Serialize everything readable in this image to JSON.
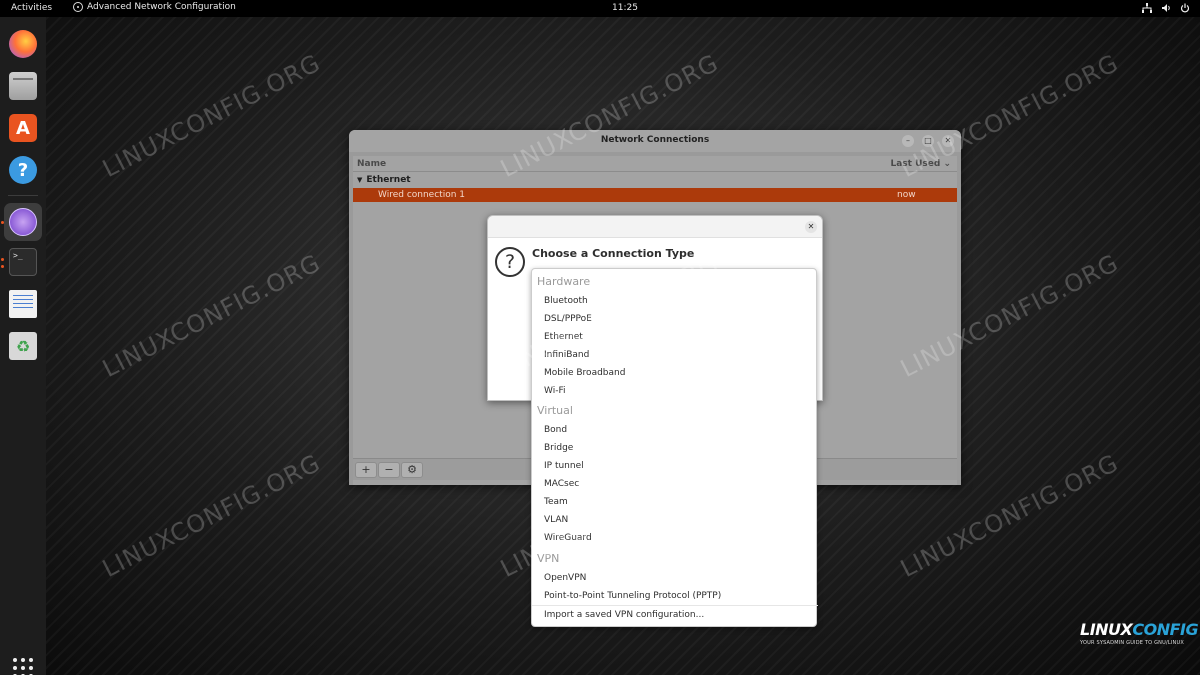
{
  "topbar": {
    "activities": "Activities",
    "app_name": "Advanced Network Configuration",
    "clock": "11:25"
  },
  "dock": {
    "items": [
      "firefox-icon",
      "files-icon",
      "software-icon",
      "help-icon",
      "network-editor-icon",
      "terminal-icon",
      "text-editor-icon",
      "trash-icon"
    ],
    "terminal_glyph": ">_"
  },
  "watermark": "LINUXCONFIG.ORG",
  "network_window": {
    "title": "Network Connections",
    "columns": {
      "name": "Name",
      "last_used": "Last Used"
    },
    "group": "Ethernet",
    "rows": [
      {
        "name": "Wired connection 1",
        "last_used": "now"
      }
    ],
    "toolbar": {
      "add": "+",
      "remove": "−",
      "settings": "⚙"
    }
  },
  "dialog": {
    "heading": "Choose a Connection Type",
    "question_glyph": "?"
  },
  "menu": {
    "hardware_header": "Hardware",
    "hardware": [
      "Bluetooth",
      "DSL/PPPoE",
      "Ethernet",
      "InfiniBand",
      "Mobile Broadband",
      "Wi-Fi"
    ],
    "virtual_header": "Virtual",
    "virtual": [
      "Bond",
      "Bridge",
      "IP tunnel",
      "MACsec",
      "Team",
      "VLAN",
      "WireGuard"
    ],
    "vpn_header": "VPN",
    "vpn": [
      "OpenVPN",
      "Point-to-Point Tunneling Protocol (PPTP)"
    ],
    "import": "Import a saved VPN configuration..."
  },
  "logo": {
    "brand_a": "LINUX",
    "brand_b": "CONFIG",
    "tagline": "YOUR SYSADMIN GUIDE TO GNU/LINUX"
  },
  "colors": {
    "accent": "#e95420",
    "selection": "#ac3a0b"
  }
}
